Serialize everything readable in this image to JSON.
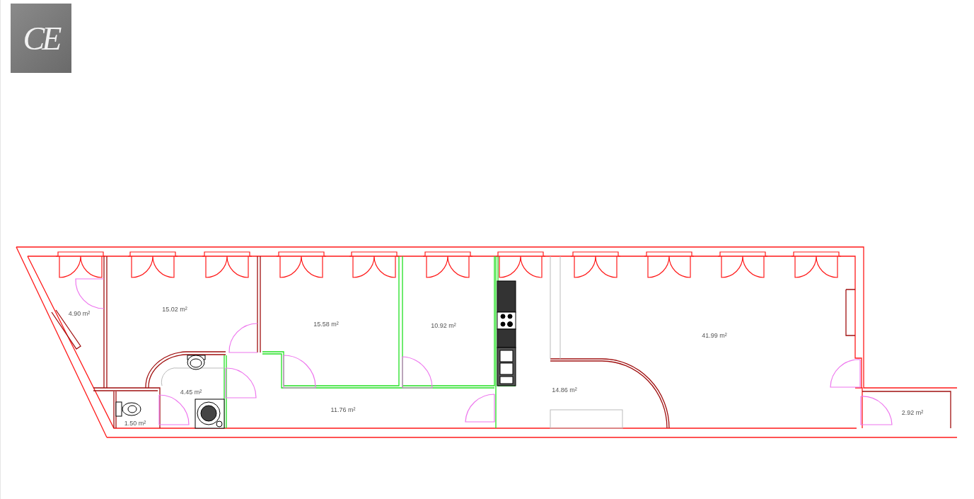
{
  "logo": {
    "text": "CE"
  },
  "rooms": [
    {
      "area": "4.90 m²"
    },
    {
      "area": "15.02 m²"
    },
    {
      "area": "15.58 m²"
    },
    {
      "area": "10.92 m²"
    },
    {
      "area": "41.99 m²"
    },
    {
      "area": "4.45 m²"
    },
    {
      "area": "14.86 m²"
    },
    {
      "area": "11.76 m²"
    },
    {
      "area": "1.50 m²"
    },
    {
      "area": "2.92 m²"
    }
  ]
}
